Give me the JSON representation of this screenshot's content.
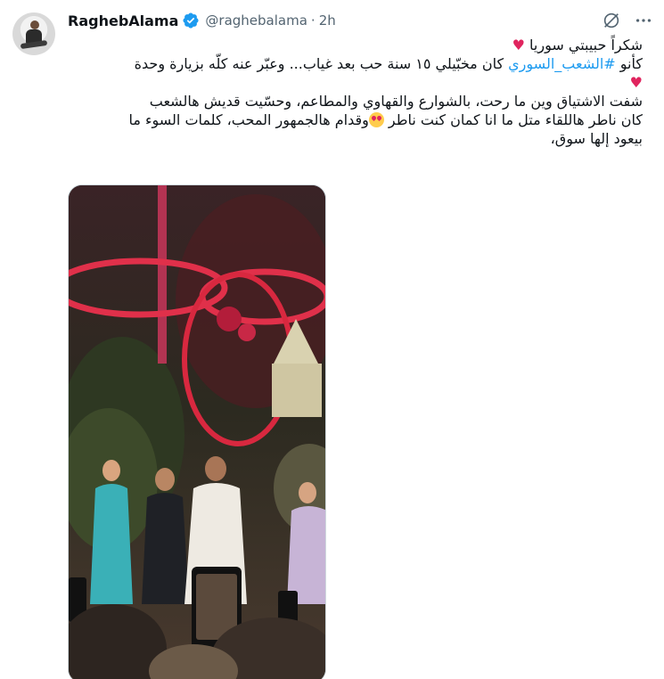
{
  "tweet": {
    "author_name": "RaghebAlama",
    "handle": "@raghebalama",
    "separator": "·",
    "timestamp": "2h",
    "lines": {
      "line1": "شكراً حبيبتي سوريا",
      "line2_prefix": "كأنو ",
      "hashtag": "#الشعب_السوري",
      "line2_suffix": " كان مخبّيلي ١٥ سنة حب بعد غياب... وعبّر عنه  كلّه بزيارة وحدة",
      "line3": "شفت الاشتياق وين ما رحت، بالشوارع والقهاوي والمطاعم، وحسّيت قديش هالشعب",
      "line4_prefix": "كان ناطر هاللقاء متل ما انا كمان كنت ناطر ",
      "line4_suffix": "وقدام هالجمهور المحب، كلمات السوء ما",
      "line5": "بيعود إلها سوق،"
    },
    "heart_glyph": "♥",
    "media_alt": "video"
  },
  "icons": {
    "avatar": "avatar",
    "verified": "verified-badge-icon",
    "grok": "grok-icon",
    "more": "more-icon",
    "heart": "heart-icon",
    "heart_eyes": "heart-eyes-emoji-icon"
  },
  "colors": {
    "text": "#0f1419",
    "secondary": "#536471",
    "link": "#1d9bf0",
    "heart": "#e0245e",
    "verified": "#1d9bf0"
  }
}
